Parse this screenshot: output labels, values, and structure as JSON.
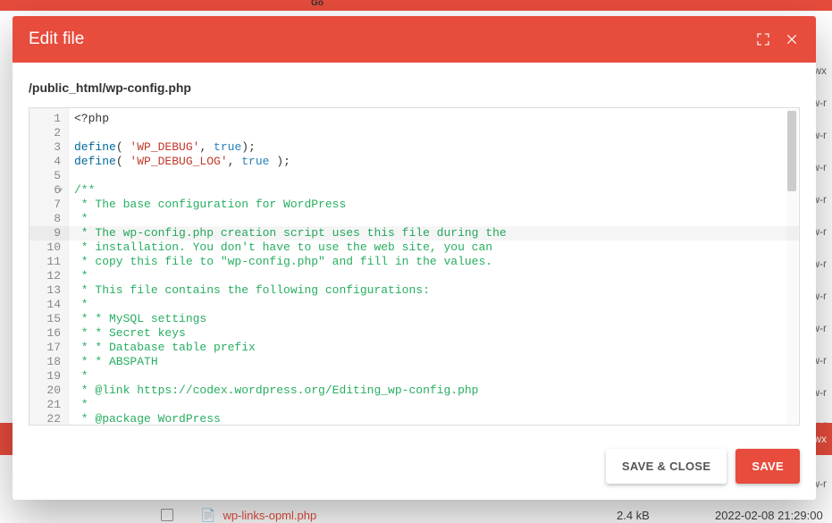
{
  "bg": {
    "go_label": "Go",
    "perms": [
      "-rwx",
      "-w-r",
      "-w-r",
      "-w-r",
      "-w-r",
      "-w-r",
      "-w-r",
      "-w-r",
      "-w-r",
      "-w-r",
      "-w-r",
      "-w-r",
      "-rwx",
      "-w-r"
    ],
    "row_tops": [
      61,
      97,
      133,
      169,
      205,
      241,
      277,
      313,
      349,
      385,
      421,
      457,
      473,
      523
    ],
    "selected_index": 12,
    "bottom": {
      "name": "wp-links-opml.php",
      "size": "2.4 kB",
      "date": "2022-02-08 21:29:00"
    }
  },
  "modal": {
    "title": "Edit file",
    "filepath": "/public_html/wp-config.php",
    "buttons": {
      "save_close": "SAVE & CLOSE",
      "save": "SAVE"
    },
    "highlighted_line": 9,
    "fold_line": 6,
    "code_lines": [
      [
        {
          "t": "php",
          "s": "<?php"
        }
      ],
      [],
      [
        {
          "t": "fn",
          "s": "define"
        },
        {
          "t": "php",
          "s": "( "
        },
        {
          "t": "str",
          "s": "'WP_DEBUG'"
        },
        {
          "t": "php",
          "s": ", "
        },
        {
          "t": "bool",
          "s": "true"
        },
        {
          "t": "php",
          "s": ");"
        }
      ],
      [
        {
          "t": "fn",
          "s": "define"
        },
        {
          "t": "php",
          "s": "( "
        },
        {
          "t": "str",
          "s": "'WP_DEBUG_LOG'"
        },
        {
          "t": "php",
          "s": ", "
        },
        {
          "t": "bool",
          "s": "true"
        },
        {
          "t": "php",
          "s": " );"
        }
      ],
      [],
      [
        {
          "t": "comm",
          "s": "/**"
        }
      ],
      [
        {
          "t": "comm",
          "s": " * The base configuration for WordPress"
        }
      ],
      [
        {
          "t": "comm",
          "s": " *"
        }
      ],
      [
        {
          "t": "comm",
          "s": " * The wp-config.php creation script uses this file during the"
        }
      ],
      [
        {
          "t": "comm",
          "s": " * installation. You don't have to use the web site, you can"
        }
      ],
      [
        {
          "t": "comm",
          "s": " * copy this file to \"wp-config.php\" and fill in the values."
        }
      ],
      [
        {
          "t": "comm",
          "s": " *"
        }
      ],
      [
        {
          "t": "comm",
          "s": " * This file contains the following configurations:"
        }
      ],
      [
        {
          "t": "comm",
          "s": " *"
        }
      ],
      [
        {
          "t": "comm",
          "s": " * * MySQL settings"
        }
      ],
      [
        {
          "t": "comm",
          "s": " * * Secret keys"
        }
      ],
      [
        {
          "t": "comm",
          "s": " * * Database table prefix"
        }
      ],
      [
        {
          "t": "comm",
          "s": " * * ABSPATH"
        }
      ],
      [
        {
          "t": "comm",
          "s": " *"
        }
      ],
      [
        {
          "t": "comm",
          "s": " * @link https://codex.wordpress.org/Editing_wp-config.php"
        }
      ],
      [
        {
          "t": "comm",
          "s": " *"
        }
      ],
      [
        {
          "t": "comm",
          "s": " * @package WordPress"
        }
      ]
    ]
  }
}
